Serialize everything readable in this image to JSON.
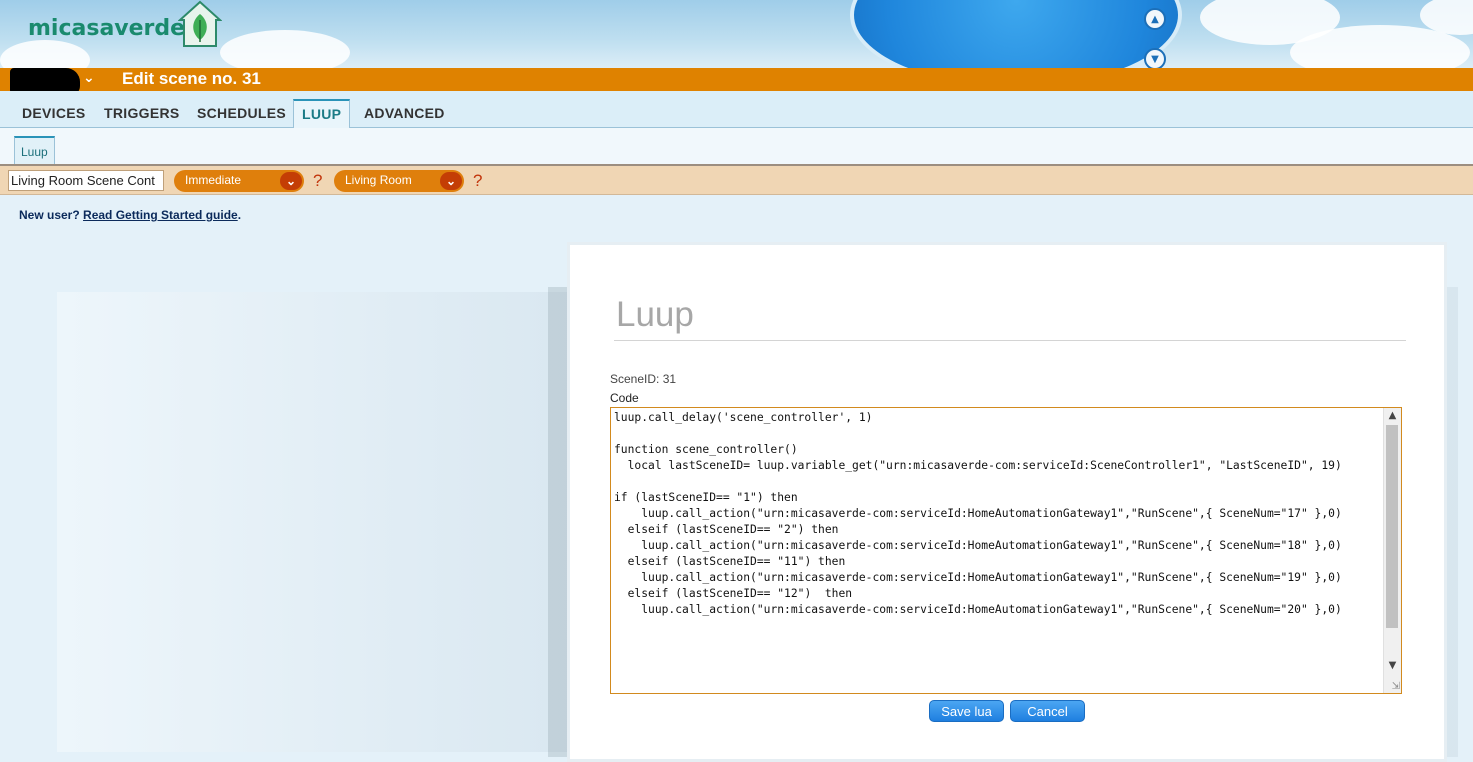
{
  "brand": {
    "logo_text": "micasaverde"
  },
  "header": {
    "title": "Edit scene no. 31"
  },
  "tabs": [
    "DEVICES",
    "TRIGGERS",
    "SCHEDULES",
    "LUUP",
    "ADVANCED"
  ],
  "active_tab": "LUUP",
  "subtab": {
    "label": "Luup"
  },
  "scene_bar": {
    "scene_name": "Living Room Scene Cont",
    "mode_select": "Immediate",
    "room_select": "Living Room",
    "help_mark": "?"
  },
  "help": {
    "prefix": "New user?",
    "link": "Read Getting Started guide",
    "suffix": "."
  },
  "dialog": {
    "title": "Luup",
    "scene_id": "SceneID: 31",
    "code_label": "Code",
    "code": "luup.call_delay('scene_controller', 1)\n\nfunction scene_controller()\n  local lastSceneID= luup.variable_get(\"urn:micasaverde-com:serviceId:SceneController1\", \"LastSceneID\", 19)\n\nif (lastSceneID== \"1\") then\n    luup.call_action(\"urn:micasaverde-com:serviceId:HomeAutomationGateway1\",\"RunScene\",{ SceneNum=\"17\" },0)\n  elseif (lastSceneID== \"2\") then\n    luup.call_action(\"urn:micasaverde-com:serviceId:HomeAutomationGateway1\",\"RunScene\",{ SceneNum=\"18\" },0)\n  elseif (lastSceneID== \"11\") then\n    luup.call_action(\"urn:micasaverde-com:serviceId:HomeAutomationGateway1\",\"RunScene\",{ SceneNum=\"19\" },0)\n  elseif (lastSceneID== \"12\")  then\n    luup.call_action(\"urn:micasaverde-com:serviceId:HomeAutomationGateway1\",\"RunScene\",{ SceneNum=\"20\" },0)",
    "save_label": "Save lua",
    "cancel_label": "Cancel"
  },
  "colors": {
    "title_bar": "#df8200",
    "scene_bar": "#f0d6b4",
    "button": "#1f7fe0",
    "dropdown": "#df7f0c"
  }
}
